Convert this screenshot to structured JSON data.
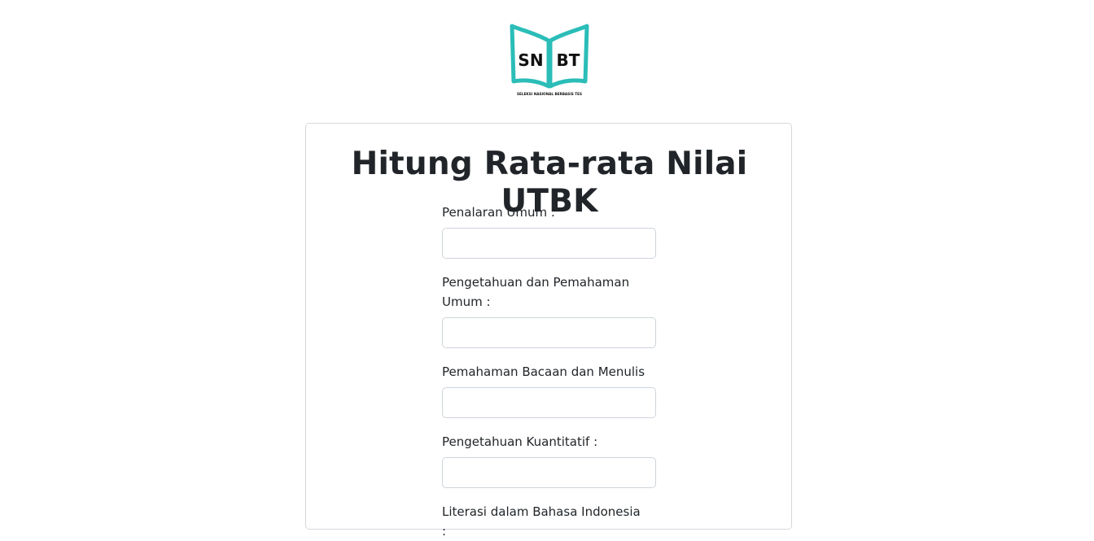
{
  "logo": {
    "text_left": "SN",
    "text_right": "BT",
    "tagline": "SELEKSI NASIONAL BERBASIS TES",
    "accent_color": "#2bbdb8"
  },
  "card": {
    "title": "Hitung Rata-rata Nilai UTBK"
  },
  "fields": [
    {
      "label": "Penalaran Umum :",
      "value": ""
    },
    {
      "label": "Pengetahuan dan Pemahaman Umum :",
      "value": ""
    },
    {
      "label": "Pemahaman Bacaan dan Menulis :",
      "value": ""
    },
    {
      "label": "Pengetahuan Kuantitatif :",
      "value": ""
    },
    {
      "label": "Literasi dalam Bahasa Indonesia :",
      "value": ""
    }
  ]
}
